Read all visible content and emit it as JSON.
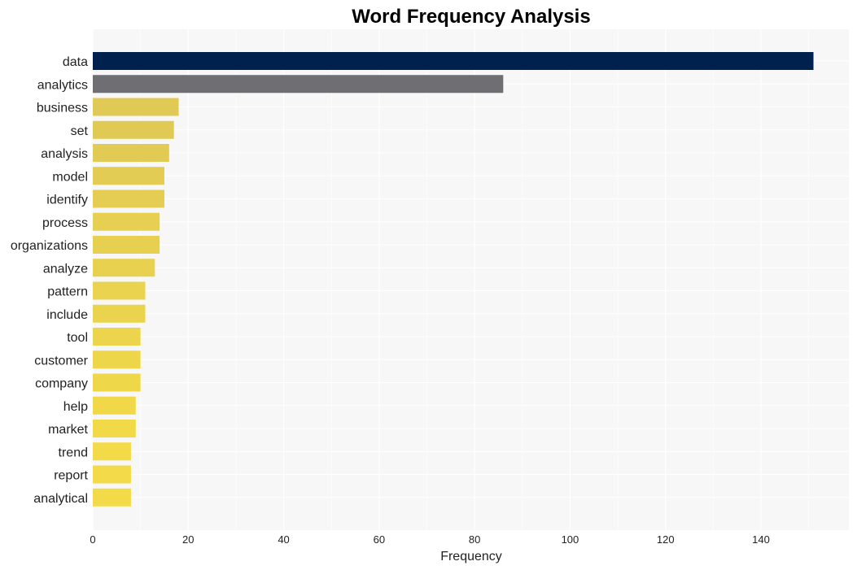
{
  "chart_data": {
    "type": "bar",
    "orientation": "horizontal",
    "title": "Word Frequency Analysis",
    "xlabel": "Frequency",
    "ylabel": "",
    "xlim": [
      0,
      158
    ],
    "xticks": [
      0,
      20,
      40,
      60,
      80,
      100,
      120,
      140
    ],
    "grid": true,
    "categories": [
      "data",
      "analytics",
      "business",
      "set",
      "analysis",
      "model",
      "identify",
      "process",
      "organizations",
      "analyze",
      "pattern",
      "include",
      "tool",
      "customer",
      "company",
      "help",
      "market",
      "trend",
      "report",
      "analytical"
    ],
    "values": [
      151,
      86,
      18,
      17,
      16,
      15,
      15,
      14,
      14,
      13,
      11,
      11,
      10,
      10,
      10,
      9,
      9,
      8,
      8,
      8
    ],
    "colors": [
      "#00204e",
      "#6f6f73",
      "#e0c955",
      "#e1ca54",
      "#e2cb54",
      "#e3cc53",
      "#e4cd52",
      "#e6cf51",
      "#e7d050",
      "#e8d14f",
      "#ead34e",
      "#ebd44d",
      "#ecd54c",
      "#eed64b",
      "#efd74a",
      "#f0d849",
      "#f1d948",
      "#f2da48",
      "#f2da48",
      "#f2da48"
    ]
  }
}
